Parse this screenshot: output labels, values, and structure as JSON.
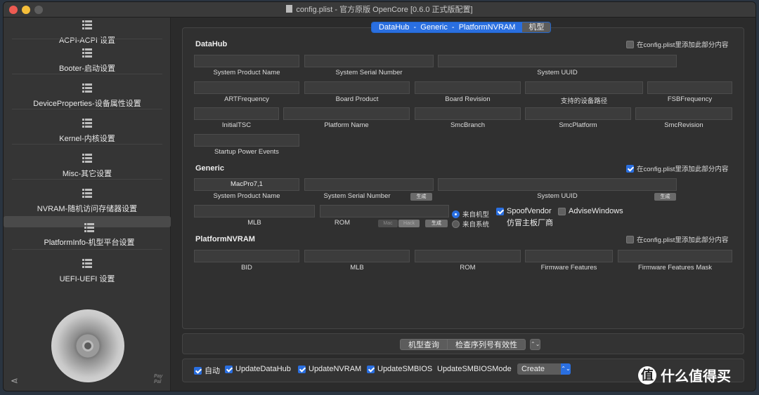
{
  "window": {
    "title": "config.plist - 官方原版 OpenCore [0.6.0 正式版配置]"
  },
  "sidebar": {
    "items": [
      {
        "label": "ACPI-ACPI 设置"
      },
      {
        "label": "Booter-启动设置"
      },
      {
        "label": "DeviceProperties-设备属性设置"
      },
      {
        "label": "Kernel-内核设置"
      },
      {
        "label": "Misc-其它设置"
      },
      {
        "label": "NVRAM-随机访问存储器设置"
      },
      {
        "label": "PlatformInfo-机型平台设置"
      },
      {
        "label": "UEFI-UEFI 设置"
      }
    ],
    "paypal": "Pay\nPal"
  },
  "tabs": {
    "active": "DataHub  -  Generic  -  PlatformNVRAM",
    "other": "机型"
  },
  "datahub": {
    "title": "DataHub",
    "add_label": "在config.plist里添加此部分内容",
    "add_checked": false,
    "fields": {
      "system_product_name": "System Product Name",
      "system_serial_number": "System Serial Number",
      "system_uuid": "System UUID",
      "art_frequency": "ARTFrequency",
      "board_product": "Board Product",
      "board_revision": "Board Revision",
      "device_path": "支持的设备路径",
      "fsb_frequency": "FSBFrequency",
      "initial_tsc": "InitialTSC",
      "platform_name": "Platform Name",
      "smc_branch": "SmcBranch",
      "smc_platform": "SmcPlatform",
      "smc_revision": "SmcRevision",
      "startup_power_events": "Startup Power Events"
    }
  },
  "generic": {
    "title": "Generic",
    "add_label": "在config.plist里添加此部分内容",
    "add_checked": true,
    "system_product_name_value": "MacPro7,1",
    "fields": {
      "system_product_name": "System Product Name",
      "system_serial_number": "System Serial Number",
      "system_uuid": "System UUID",
      "mlb": "MLB",
      "rom": "ROM"
    },
    "generate": "生成",
    "mac": "Mac",
    "hack": "Hack",
    "radio_from_model": "来自机型",
    "radio_from_system": "来自系统",
    "spoof_vendor": "SpoofVendor",
    "advise_windows": "AdviseWindows",
    "spoof_sub": "仿冒主板厂商"
  },
  "platform_nvram": {
    "title": "PlatformNVRAM",
    "add_label": "在config.plist里添加此部分内容",
    "add_checked": false,
    "fields": {
      "bid": "BID",
      "mlb": "MLB",
      "rom": "ROM",
      "firmware_features": "Firmware Features",
      "firmware_features_mask": "Firmware Features Mask"
    }
  },
  "actions": {
    "model_query": "机型查询",
    "check_serial": "检查序列号有效性",
    "stepper": "⌃⌄"
  },
  "bottom": {
    "auto": "自动",
    "update_datahub": "UpdateDataHub",
    "update_nvram": "UpdateNVRAM",
    "update_smbios": "UpdateSMBIOS",
    "smbios_mode_label": "UpdateSMBIOSMode",
    "smbios_mode_value": "Create",
    "arrow": "⌃⌄"
  },
  "watermark": {
    "logo": "值",
    "text": "什么值得买"
  }
}
